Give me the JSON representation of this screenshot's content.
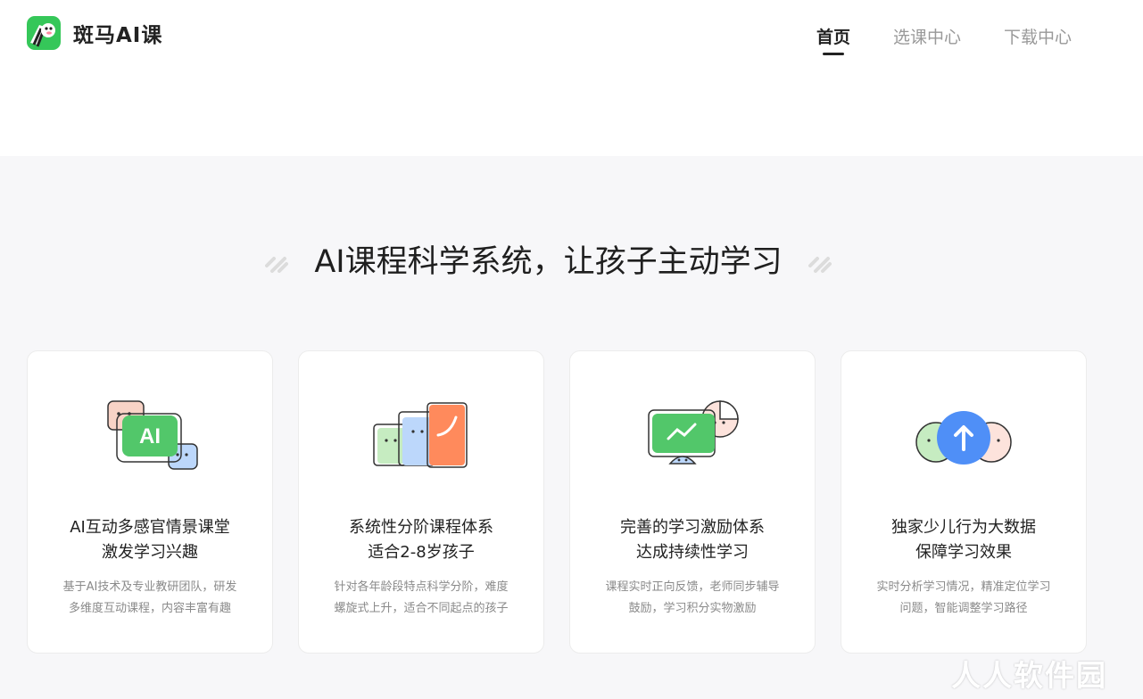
{
  "header": {
    "brand": "斑马AI课",
    "nav": [
      {
        "label": "首页",
        "active": true
      },
      {
        "label": "选课中心",
        "active": false
      },
      {
        "label": "下载中心",
        "active": false
      }
    ]
  },
  "section": {
    "title": "AI课程科学系统，让孩子主动学习"
  },
  "cards": [
    {
      "icon": "ai-chat-icon",
      "title1": "AI互动多感官情景课堂",
      "title2": "激发学习兴趣",
      "desc1": "基于AI技术及专业教研团队，研发",
      "desc2": "多维度互动课程，内容丰富有趣",
      "icon_text": "AI"
    },
    {
      "icon": "course-cards-icon",
      "title1": "系统性分阶课程体系",
      "title2": "适合2-8岁孩子",
      "desc1": "针对各年龄段特点科学分阶，难度",
      "desc2": "螺旋式上升，适合不同起点的孩子"
    },
    {
      "icon": "progress-chart-icon",
      "title1": "完善的学习激励体系",
      "title2": "达成持续性学习",
      "desc1": "课程实时正向反馈，老师同步辅导",
      "desc2": "鼓励，学习积分实物激励"
    },
    {
      "icon": "upgrade-data-icon",
      "title1": "独家少儿行为大数据",
      "title2": "保障学习效果",
      "desc1": "实时分析学习情况，精准定位学习",
      "desc2": "问题，智能调整学习路径"
    }
  ],
  "watermark": "人人软件园",
  "colors": {
    "brand_green": "#35c759",
    "accent_orange": "#ff8a5c",
    "accent_blue": "#4f8ff7",
    "page_bg": "#f7f7f9"
  }
}
